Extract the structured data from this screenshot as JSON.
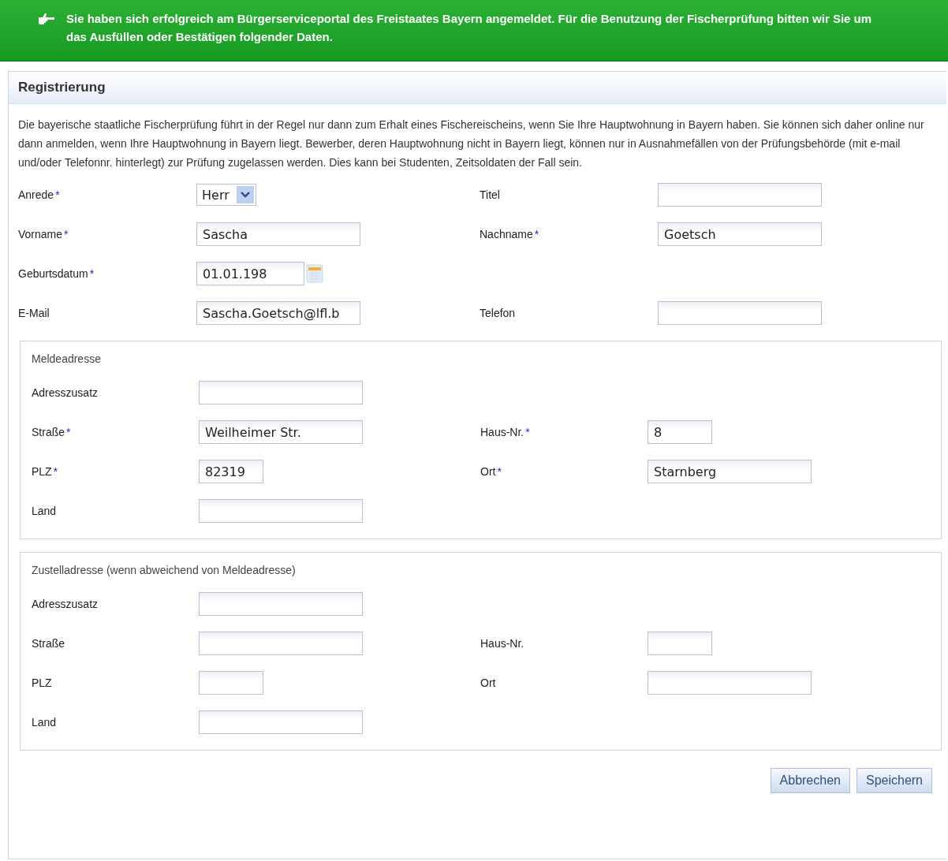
{
  "banner": {
    "message": "Sie haben sich erfolgreich am Bürgerserviceportal des Freistaates Bayern angemeldet. Für die Benutzung der Fischerprüfung bitten wir Sie um das Ausfüllen oder Bestätigen folgender Daten."
  },
  "panel": {
    "title": "Registrierung",
    "intro": "Die bayerische staatliche Fischerprüfung führt in der Regel nur dann zum Erhalt eines Fischereischeins, wenn Sie Ihre Hauptwohnung in Bayern haben. Sie können sich daher online nur dann anmelden, wenn Ihre Hauptwohnung in Bayern liegt. Bewerber, deren Hauptwohnung nicht in Bayern liegt, können nur in Ausnahmefällen von der Prüfungsbehörde (mit e-mail und/oder Telefonnr. hinterlegt) zur Prüfung zugelassen werden. Dies kann bei Studenten, Zeitsoldaten der Fall sein.",
    "rows": [
      {
        "fields": [
          {
            "label": "Anrede",
            "required": "*",
            "kind": "select",
            "value": "Herr"
          },
          {
            "label": "Titel",
            "kind": "text"
          }
        ]
      },
      {
        "fields": [
          {
            "label": "Vorname",
            "required": "*",
            "kind": "text",
            "value": "Sascha"
          },
          {
            "label": "Nachname",
            "required": "*",
            "kind": "text",
            "value": "Goetsch"
          }
        ]
      },
      {
        "fields": [
          {
            "label": "Geburtsdatum",
            "required": "*",
            "kind": "date",
            "value": "01.01.198"
          }
        ]
      },
      {
        "fields": [
          {
            "label": "E-Mail",
            "kind": "text",
            "value": "Sascha.Goetsch@lfl.b"
          },
          {
            "label": "Telefon",
            "kind": "text"
          }
        ]
      }
    ],
    "sections": [
      {
        "legend": "Meldeadresse",
        "rows": [
          {
            "fields": [
              {
                "label": "Adresszusatz",
                "kind": "text"
              }
            ]
          },
          {
            "fields": [
              {
                "label": "Straße",
                "required": "*",
                "kind": "text",
                "value": "Weilheimer Str."
              },
              {
                "label": "Haus-Nr.",
                "required": "*",
                "kind": "short",
                "value": "8"
              }
            ]
          },
          {
            "fields": [
              {
                "label": "PLZ",
                "required": "*",
                "kind": "short",
                "value": "82319"
              },
              {
                "label": "Ort",
                "required": "*",
                "kind": "text",
                "value": "Starnberg"
              }
            ]
          },
          {
            "fields": [
              {
                "label": "Land",
                "kind": "text"
              }
            ]
          }
        ]
      },
      {
        "legend": "Zustelladresse (wenn abweichend von Meldeadresse)",
        "rows": [
          {
            "fields": [
              {
                "label": "Adresszusatz",
                "kind": "text"
              }
            ]
          },
          {
            "fields": [
              {
                "label": "Straße",
                "kind": "text"
              },
              {
                "label": "Haus-Nr.",
                "kind": "short"
              }
            ]
          },
          {
            "fields": [
              {
                "label": "PLZ",
                "kind": "short"
              },
              {
                "label": "Ort",
                "kind": "text"
              }
            ]
          },
          {
            "fields": [
              {
                "label": "Land",
                "kind": "text"
              }
            ]
          }
        ]
      }
    ],
    "buttons": [
      "Abbrechen",
      "Speichern"
    ]
  }
}
